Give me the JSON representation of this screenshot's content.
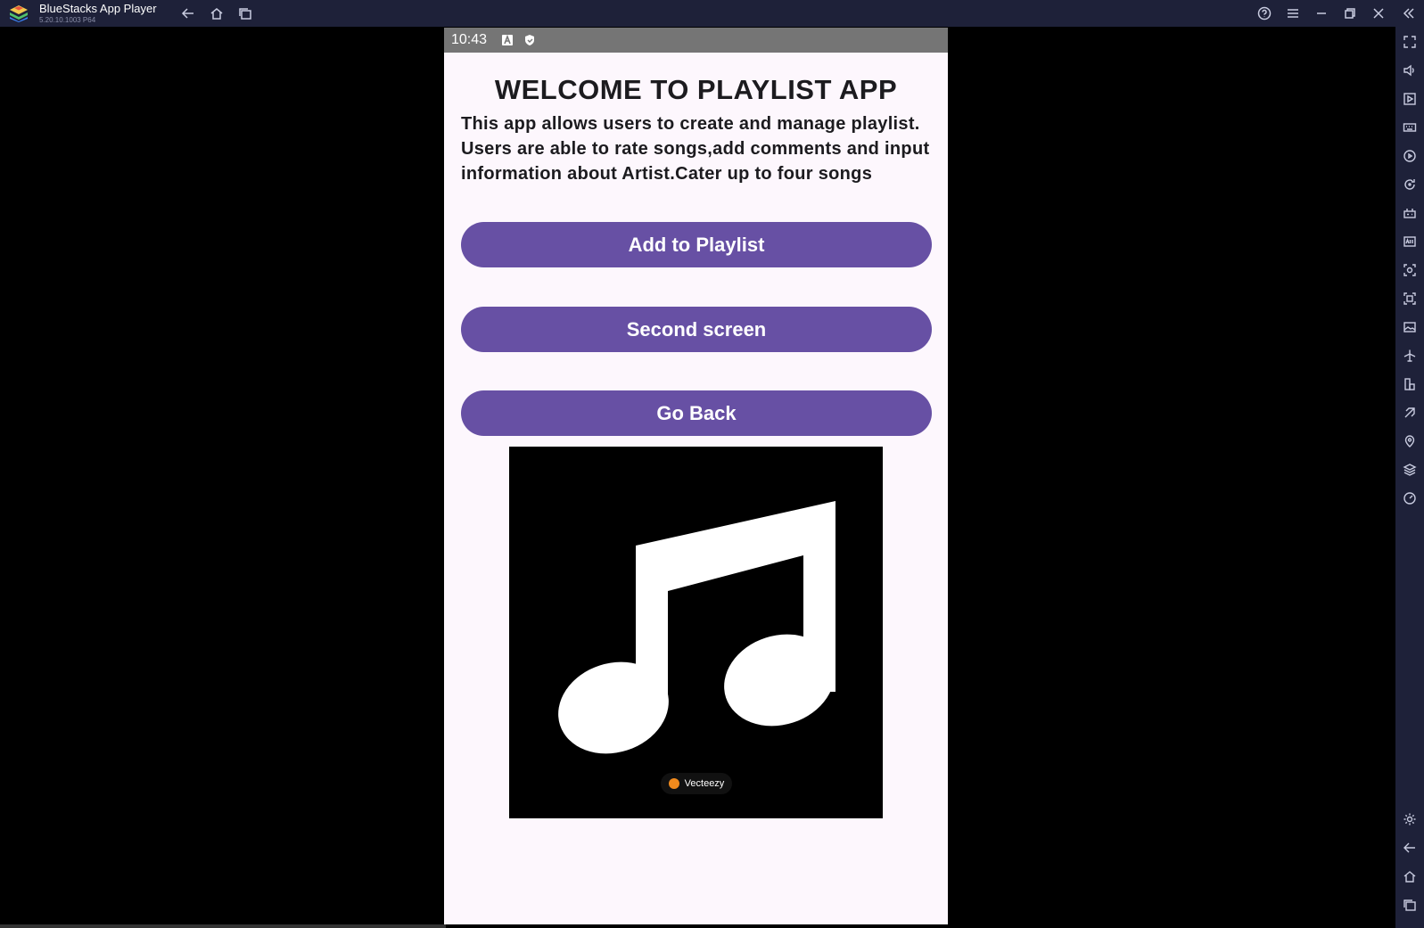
{
  "titlebar": {
    "app_name": "BlueStacks App Player",
    "version": "5.20.10.1003 P64",
    "nav_icons": [
      "back-arrow-icon",
      "home-icon",
      "recent-apps-icon"
    ],
    "window_icons": [
      "help-icon",
      "menu-icon",
      "minimize-icon",
      "restore-icon",
      "close-icon",
      "collapse-sidebar-icon"
    ]
  },
  "sidebar": {
    "icons": [
      "fullscreen-icon",
      "volume-icon",
      "media-play-icon",
      "keyboard-icon",
      "macro-icon",
      "rotate-icon",
      "gamepad-icon",
      "apk-install-icon",
      "screenshot-icon",
      "record-icon",
      "media-folder-icon",
      "airplane-icon",
      "multi-instance-icon",
      "eco-mode-icon",
      "location-icon",
      "layers-icon",
      "performance-icon",
      "settings-icon",
      "back-icon",
      "home-icon",
      "recents-icon"
    ]
  },
  "status_bar": {
    "time": "10:43",
    "icons": [
      "notification-a-icon",
      "shield-icon"
    ]
  },
  "app": {
    "headline": "WELCOME TO PLAYLIST APP",
    "description": "This app allows users to create and manage playlist. Users are able to rate songs,add comments and input information about Artist.Cater up to four songs",
    "buttons": {
      "add_to_playlist": "Add to Playlist",
      "second_screen": "Second screen",
      "go_back": "Go Back"
    },
    "image": {
      "icon": "music-note-icon",
      "watermark": "Vecteezy"
    }
  },
  "colors": {
    "button": "#6750a4",
    "screen_background": "#fdf7fd",
    "status_bar": "#757575",
    "chrome": "#1e2139"
  }
}
